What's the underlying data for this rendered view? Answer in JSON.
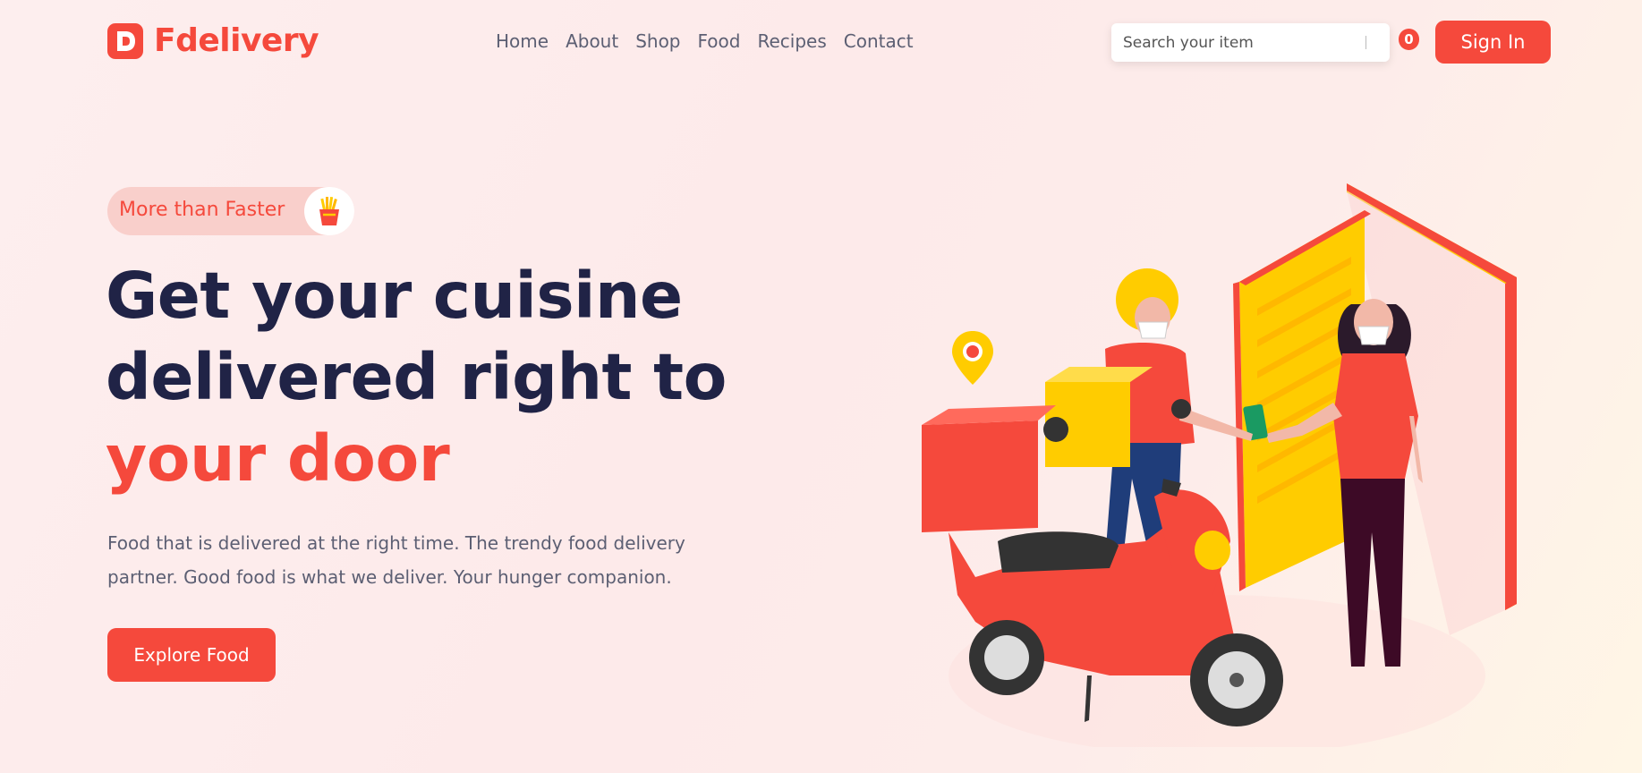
{
  "brand": {
    "logo_letter": "D",
    "name": "Fdelivery"
  },
  "nav": {
    "items": [
      {
        "label": "Home"
      },
      {
        "label": "About"
      },
      {
        "label": "Shop"
      },
      {
        "label": "Food"
      },
      {
        "label": "Recipes"
      },
      {
        "label": "Contact"
      }
    ]
  },
  "search": {
    "placeholder": "Search your item",
    "value": ""
  },
  "cart": {
    "count": "0",
    "icon": "cart-badge"
  },
  "header": {
    "signin_label": "Sign In"
  },
  "hero": {
    "badge_text": "More than Faster",
    "badge_icon": "fries-icon",
    "headline_line1": "Get your cuisine",
    "headline_line2": "delivered right to",
    "headline_accent": "your door",
    "description": "Food that is delivered at the right time. The trendy food delivery partner. Good food is what we deliver. Your hunger companion.",
    "cta_label": "Explore Food"
  },
  "colors": {
    "accent": "#f5493c",
    "heading": "#202346",
    "body_text": "#5c5f73",
    "yellow": "#ffcc00"
  }
}
